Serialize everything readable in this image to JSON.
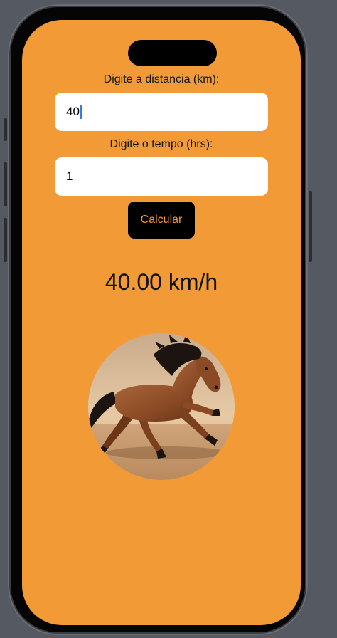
{
  "form": {
    "distance_label": "Digite a distancia (km):",
    "distance_value": "40",
    "time_label": "Digite o tempo (hrs):",
    "time_value": "1",
    "calculate_label": "Calcular"
  },
  "result": {
    "speed_text": "40.00 km/h"
  },
  "image": {
    "subject": "running-horse-photo"
  },
  "colors": {
    "background": "#f29a36",
    "button_background": "#000000",
    "button_text": "#f29a36",
    "caret": "#3478f6"
  }
}
